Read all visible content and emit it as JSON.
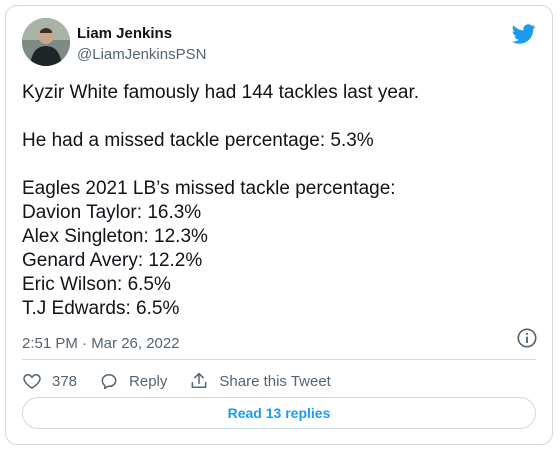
{
  "author": {
    "name": "Liam Jenkins",
    "handle": "@LiamJenkinsPSN",
    "avatar_icon": "person-avatar"
  },
  "brand": {
    "icon": "twitter-bird-icon",
    "color": "#1d9bf0"
  },
  "tweet": {
    "text": "Kyzir White famously had 144 tackles last year.\n\nHe had a missed tackle percentage: 5.3%\n\nEagles 2021 LB’s missed tackle percentage:\nDavion Taylor: 16.3%\nAlex Singleton: 12.3%\nGenard Avery: 12.2%\nEric Wilson: 6.5%\nT.J Edwards: 6.5%",
    "timestamp": "2:51 PM · Mar 26, 2022"
  },
  "actions": {
    "likes_count": "378",
    "reply_label": "Reply",
    "share_label": "Share this Tweet"
  },
  "replies_button": {
    "label": "Read 13 replies"
  }
}
